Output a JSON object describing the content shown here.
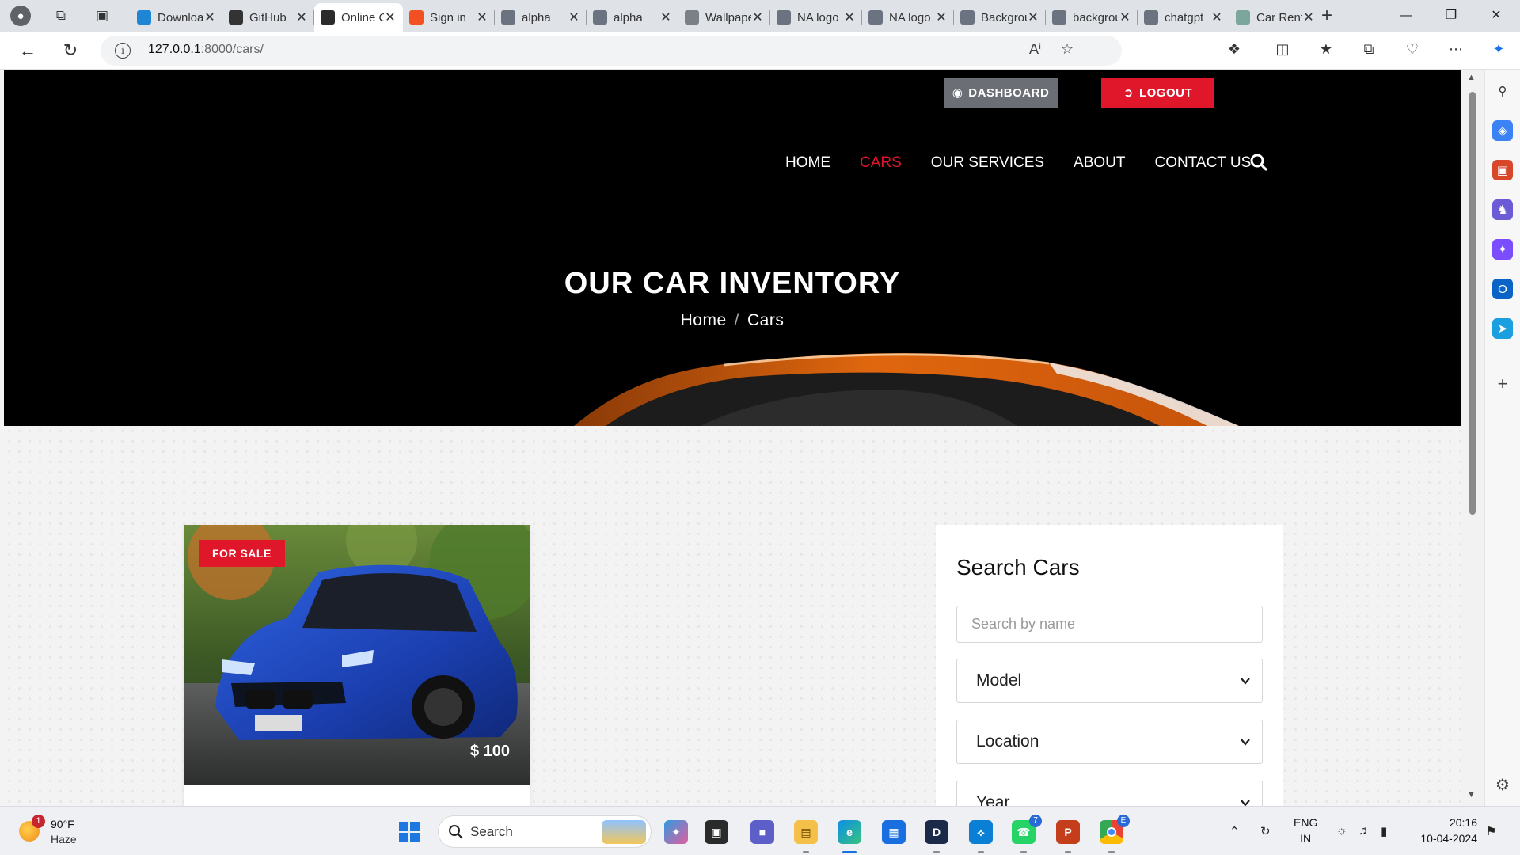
{
  "browser": {
    "tabs": [
      {
        "label": "Downloads",
        "icon": "vscode-icon",
        "color": "#1f86d6"
      },
      {
        "label": "GitHub",
        "icon": "github-icon",
        "color": "#333333"
      },
      {
        "label": "Online Car Dealership",
        "icon": "site-icon",
        "color": "#2b2b2b"
      },
      {
        "label": "Sign in",
        "icon": "microsoft-icon",
        "color": "#f25022"
      },
      {
        "label": "alpha",
        "icon": "search-icon",
        "color": "#6b7280"
      },
      {
        "label": "alpha",
        "icon": "search-icon",
        "color": "#6b7280"
      },
      {
        "label": "Wallpapers",
        "icon": "image-icon",
        "color": "#7b7f86"
      },
      {
        "label": "NA logo",
        "icon": "search-icon",
        "color": "#6b7280"
      },
      {
        "label": "NA logo",
        "icon": "search-icon",
        "color": "#6b7280"
      },
      {
        "label": "Background",
        "icon": "search-icon",
        "color": "#6b7280"
      },
      {
        "label": "background",
        "icon": "search-icon",
        "color": "#6b7280"
      },
      {
        "label": "chatgpt",
        "icon": "search-icon",
        "color": "#6b7280"
      },
      {
        "label": "Car Rental",
        "icon": "chatgpt-icon",
        "color": "#7aa69b"
      }
    ],
    "active_tab": 2,
    "url_host": "127.0.0.1",
    "url_path": ":8000/cars/"
  },
  "site": {
    "top_buttons": {
      "dashboard": "DASHBOARD",
      "logout": "LOGOUT"
    },
    "nav": [
      {
        "label": "HOME",
        "active": false
      },
      {
        "label": "CARS",
        "active": true
      },
      {
        "label": "OUR SERVICES",
        "active": false
      },
      {
        "label": "ABOUT",
        "active": false
      },
      {
        "label": "CONTACT US",
        "active": false
      }
    ],
    "hero_title": "OUR CAR INVENTORY",
    "breadcrumb": {
      "home": "Home",
      "current": "Cars",
      "separator": "/"
    },
    "accent_color": "#e0162b",
    "car": {
      "badge": "FOR SALE",
      "price": "$ 100"
    },
    "search": {
      "title": "Search Cars",
      "name_placeholder": "Search by name",
      "model": "Model",
      "location": "Location",
      "year": "Year"
    }
  },
  "taskbar": {
    "weather_temp": "90°F",
    "weather_desc": "Haze",
    "weather_badge": "1",
    "search_label": "Search",
    "lang_top": "ENG",
    "lang_bottom": "IN",
    "time": "20:16",
    "date": "10-04-2024",
    "whatsapp_badge": "7",
    "chrome_badge": "E"
  }
}
